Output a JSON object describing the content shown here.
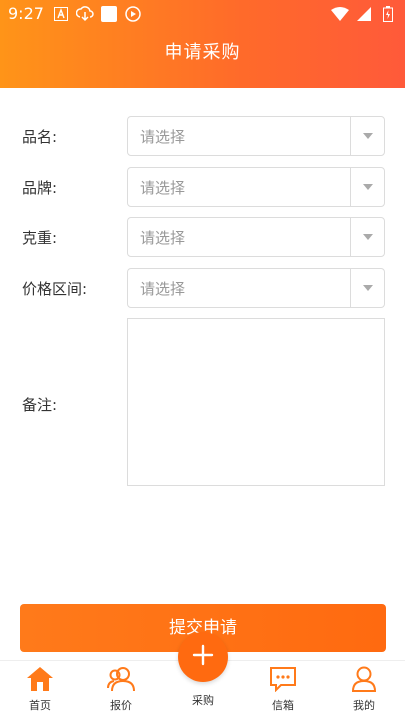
{
  "status_bar": {
    "time": "9:27"
  },
  "header": {
    "title": "申请采购"
  },
  "form": {
    "fields": [
      {
        "label": "品名:",
        "placeholder": "请选择"
      },
      {
        "label": "品牌:",
        "placeholder": "请选择"
      },
      {
        "label": "克重:",
        "placeholder": "请选择"
      },
      {
        "label": "价格区间:",
        "placeholder": "请选择"
      }
    ],
    "remark_label": "备注:",
    "remark_value": ""
  },
  "submit": {
    "label": "提交申请"
  },
  "tabbar": {
    "items": [
      {
        "label": "首页",
        "icon": "home-icon"
      },
      {
        "label": "报价",
        "icon": "users-icon"
      },
      {
        "label": "采购",
        "icon": "plus-icon"
      },
      {
        "label": "信箱",
        "icon": "message-icon"
      },
      {
        "label": "我的",
        "icon": "user-icon"
      }
    ]
  },
  "colors": {
    "accent": "#ff6a10",
    "header_start": "#ff9418",
    "header_end": "#ff5a3a"
  }
}
